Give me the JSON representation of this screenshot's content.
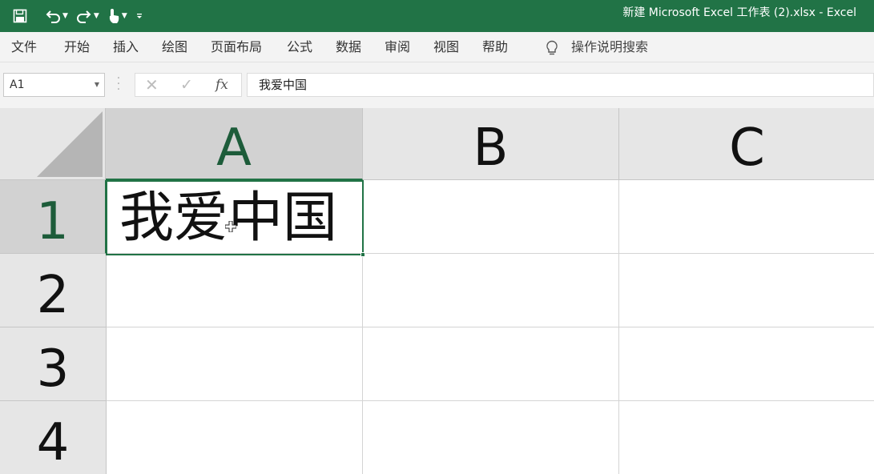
{
  "app": {
    "title": "新建 Microsoft Excel 工作表 (2).xlsx  -  Excel",
    "accent_color": "#217346"
  },
  "quick_access": {
    "icons": [
      "save-icon",
      "undo-icon",
      "redo-icon",
      "touch-mode-icon",
      "customize-icon"
    ]
  },
  "ribbon": {
    "tabs": [
      "文件",
      "开始",
      "插入",
      "绘图",
      "页面布局",
      "公式",
      "数据",
      "审阅",
      "视图",
      "帮助"
    ],
    "tell_me": "操作说明搜索"
  },
  "formula_bar": {
    "name_box": "A1",
    "cancel": "✕",
    "enter": "✓",
    "fx": "fx",
    "content": "我爱中国"
  },
  "grid": {
    "columns": [
      "A",
      "B",
      "C"
    ],
    "rows": [
      "1",
      "2",
      "3",
      "4"
    ],
    "selected_cell": "A1",
    "cells": {
      "A1": "我爱中国"
    }
  }
}
